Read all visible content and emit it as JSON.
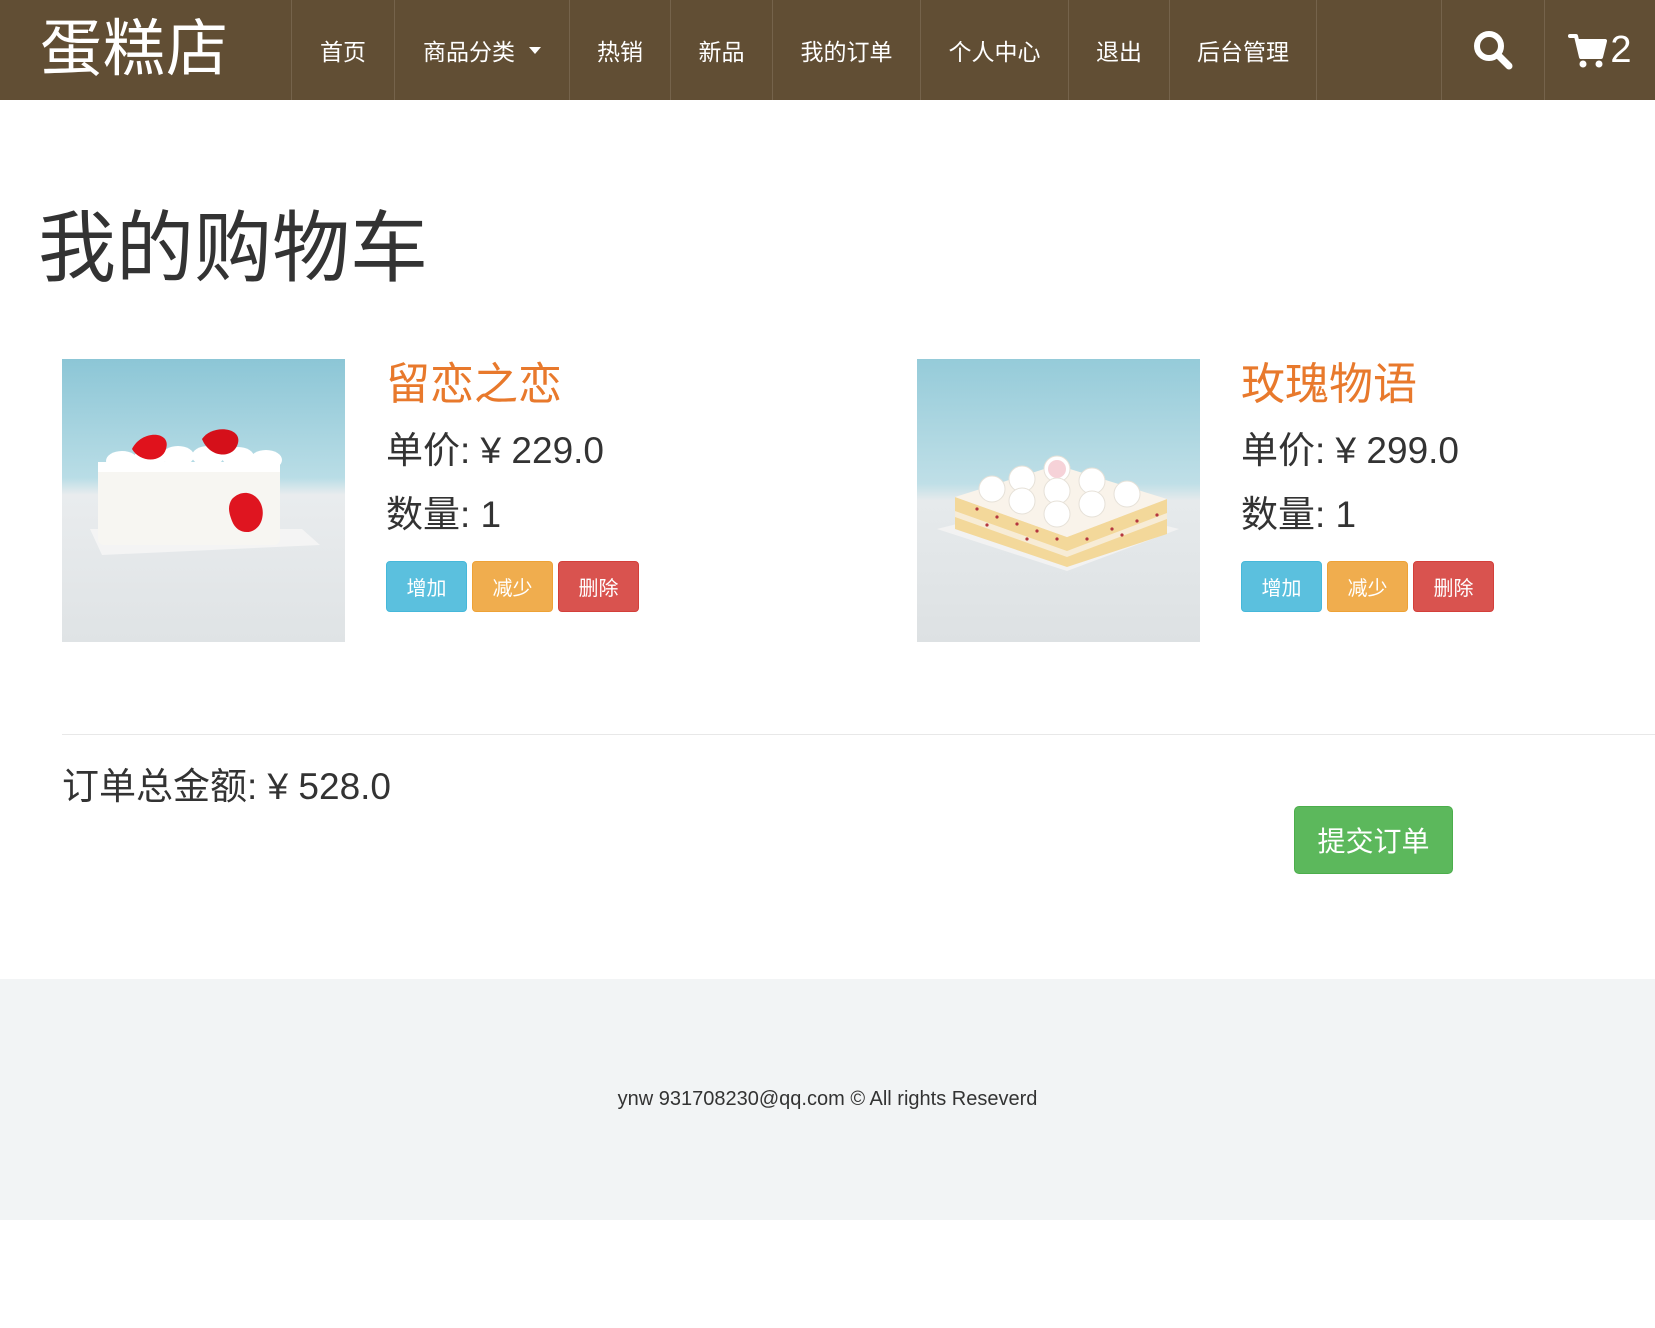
{
  "brand": "蛋糕店",
  "nav": {
    "items": [
      {
        "label": "首页"
      },
      {
        "label": "商品分类"
      },
      {
        "label": "热销"
      },
      {
        "label": "新品"
      },
      {
        "label": "我的订单"
      },
      {
        "label": "个人中心"
      },
      {
        "label": "退出"
      },
      {
        "label": "后台管理"
      }
    ],
    "search_icon": "search-icon",
    "cart_icon": "cart-icon",
    "cart_count": "2"
  },
  "page_title": "我的购物车",
  "cart": {
    "items": [
      {
        "name": "留恋之恋",
        "price_label": "单价: ¥ 229.0",
        "qty_label": "数量: 1",
        "image": "white square cake with red rose petals",
        "buttons": {
          "increase": "增加",
          "decrease": "减少",
          "delete": "删除"
        }
      },
      {
        "name": "玫瑰物语",
        "price_label": "单价: ¥ 299.0",
        "qty_label": "数量: 1",
        "image": "layered square cake topped with white cream roses",
        "buttons": {
          "increase": "增加",
          "decrease": "减少",
          "delete": "删除"
        }
      }
    ],
    "total_label": "订单总金额: ¥ 528.0",
    "submit_label": "提交订单"
  },
  "footer": {
    "text": "ynw 931708230@qq.com © All rights Reseverd"
  },
  "colors": {
    "navbar": "#614e34",
    "item_name": "#e8792c",
    "btn_info": "#5bc0de",
    "btn_warning": "#f0ad4e",
    "btn_danger": "#d9534f",
    "btn_success": "#5cb85c",
    "footer_bg": "#f2f4f5"
  }
}
